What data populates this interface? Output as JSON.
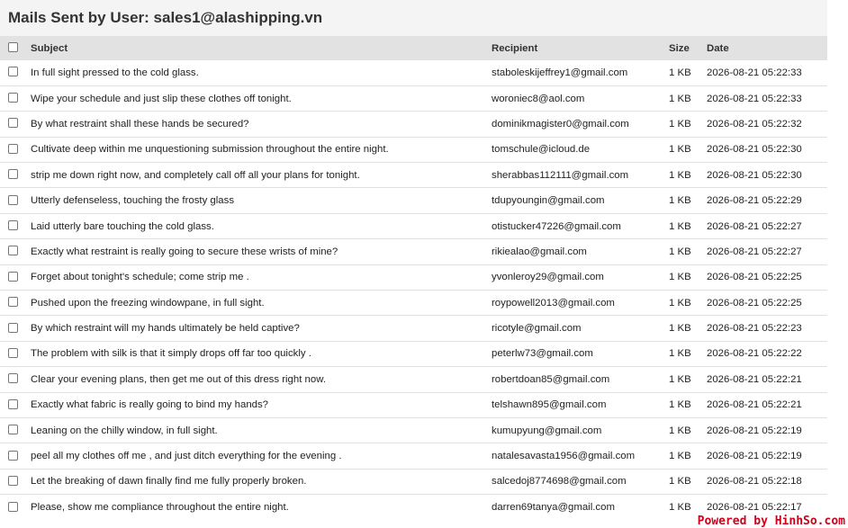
{
  "page": {
    "title": "Mails Sent by User: sales1@alashipping.vn"
  },
  "table": {
    "headers": {
      "subject": "Subject",
      "recipient": "Recipient",
      "size": "Size",
      "date": "Date"
    },
    "rows": [
      {
        "subject": "In full sight pressed to the cold glass.",
        "recipient": "staboleskijeffrey1@gmail.com",
        "size": "1 KB",
        "date": "2026-08-21 05:22:33"
      },
      {
        "subject": "Wipe your schedule and just slip these clothes off tonight.",
        "recipient": "woroniec8@aol.com",
        "size": "1 KB",
        "date": "2026-08-21 05:22:33"
      },
      {
        "subject": "By what restraint shall these hands be secured?",
        "recipient": "dominikmagister0@gmail.com",
        "size": "1 KB",
        "date": "2026-08-21 05:22:32"
      },
      {
        "subject": "Cultivate deep within me unquestioning submission throughout the entire night.",
        "recipient": "tomschule@icloud.de",
        "size": "1 KB",
        "date": "2026-08-21 05:22:30"
      },
      {
        "subject": "strip me down right now, and completely call off all your plans for tonight.",
        "recipient": "sherabbas112111@gmail.com",
        "size": "1 KB",
        "date": "2026-08-21 05:22:30"
      },
      {
        "subject": "Utterly defenseless, touching the frosty glass",
        "recipient": "tdupyoungin@gmail.com",
        "size": "1 KB",
        "date": "2026-08-21 05:22:29"
      },
      {
        "subject": "Laid utterly bare touching the cold glass.",
        "recipient": "otistucker47226@gmail.com",
        "size": "1 KB",
        "date": "2026-08-21 05:22:27"
      },
      {
        "subject": "Exactly what restraint is really going to secure these wrists of mine?",
        "recipient": "rikiealao@gmail.com",
        "size": "1 KB",
        "date": "2026-08-21 05:22:27"
      },
      {
        "subject": "Forget about tonight's schedule; come strip me .",
        "recipient": "yvonleroy29@gmail.com",
        "size": "1 KB",
        "date": "2026-08-21 05:22:25"
      },
      {
        "subject": "Pushed upon the freezing windowpane, in full sight.",
        "recipient": "roypowell2013@gmail.com",
        "size": "1 KB",
        "date": "2026-08-21 05:22:25"
      },
      {
        "subject": "By which restraint will my hands ultimately be held captive?",
        "recipient": "ricotyle@gmail.com",
        "size": "1 KB",
        "date": "2026-08-21 05:22:23"
      },
      {
        "subject": "The problem with silk is that it simply drops off far too quickly .",
        "recipient": "peterlw73@gmail.com",
        "size": "1 KB",
        "date": "2026-08-21 05:22:22"
      },
      {
        "subject": "Clear your evening plans, then get me out of this dress right now.",
        "recipient": "robertdoan85@gmail.com",
        "size": "1 KB",
        "date": "2026-08-21 05:22:21"
      },
      {
        "subject": "Exactly what fabric is really going to bind my hands?",
        "recipient": "telshawn895@gmail.com",
        "size": "1 KB",
        "date": "2026-08-21 05:22:21"
      },
      {
        "subject": "Leaning on the chilly window, in full sight.",
        "recipient": "kumupyung@gmail.com",
        "size": "1 KB",
        "date": "2026-08-21 05:22:19"
      },
      {
        "subject": "peel all my clothes off me , and just ditch everything for the evening .",
        "recipient": "natalesavasta1956@gmail.com",
        "size": "1 KB",
        "date": "2026-08-21 05:22:19"
      },
      {
        "subject": "Let the breaking of dawn finally find me fully properly broken.",
        "recipient": "salcedoj8774698@gmail.com",
        "size": "1 KB",
        "date": "2026-08-21 05:22:18"
      },
      {
        "subject": "Please, show me compliance throughout the entire night.",
        "recipient": "darren69tanya@gmail.com",
        "size": "1 KB",
        "date": "2026-08-21 05:22:17"
      }
    ]
  },
  "footer": {
    "brand": "Powered by HinhSo.com"
  },
  "colors": {
    "header_bg": "#e2e2e2",
    "title_bg": "#f4f4f4",
    "brand": "#d0021b"
  }
}
